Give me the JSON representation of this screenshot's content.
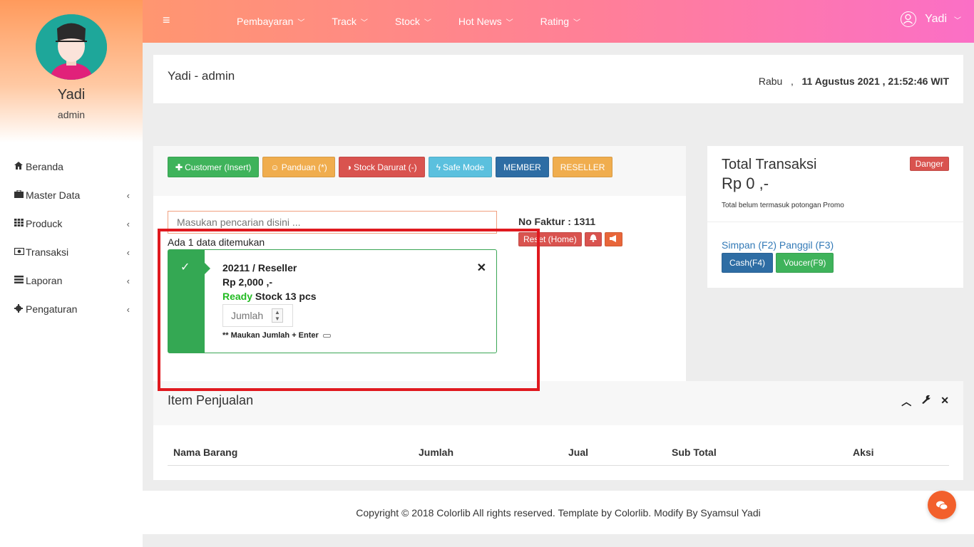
{
  "sidebar": {
    "profile": {
      "name": "Yadi",
      "role": "admin"
    },
    "items": [
      {
        "label": "Beranda",
        "icon": "home-icon",
        "has_arrow": false
      },
      {
        "label": "Master Data",
        "icon": "briefcase-icon",
        "has_arrow": true
      },
      {
        "label": "Produck",
        "icon": "grid-icon",
        "has_arrow": true
      },
      {
        "label": "Transaksi",
        "icon": "money-icon",
        "has_arrow": true
      },
      {
        "label": "Laporan",
        "icon": "list-icon",
        "has_arrow": true
      },
      {
        "label": "Pengaturan",
        "icon": "gear-icon",
        "has_arrow": true
      }
    ],
    "arrow": "‹"
  },
  "topbar": {
    "menu_icon": "≡",
    "nav": [
      "Pembayaran",
      "Track",
      "Stock",
      "Hot News",
      "Rating"
    ],
    "user": "Yadi"
  },
  "header": {
    "title": "Yadi - admin",
    "day": "Rabu",
    "separator": ",",
    "datetime": "11 Agustus 2021 , 21:52:46 WIT"
  },
  "actions": {
    "customer": "Customer (Insert)",
    "panduan": "Panduan (*)",
    "stock_darurat": "Stock Darurat (-)",
    "safe_mode": "Safe Mode",
    "member": "MEMBER",
    "reseller": "RESELLER"
  },
  "search": {
    "placeholder": "Masukan pencarian disini ...",
    "found_text": "Ada 1 data ditemukan"
  },
  "faktur": {
    "label": "No Faktur : 1311",
    "reset": "Reset (Home)"
  },
  "result": {
    "title": "20211 / Reseller",
    "price": "Rp 2,000 ,-",
    "ready": "Ready",
    "stock": "Stock 13 pcs",
    "qty_placeholder": "Jumlah",
    "hint": "** Maukan Jumlah + Enter"
  },
  "summary": {
    "title": "Total Transaksi",
    "amount": "Rp 0 ,-",
    "note": "Total belum termasuk potongan Promo",
    "danger": "Danger",
    "simpan": "Simpan (F2)",
    "panggil": "Panggil (F3)",
    "cash": "Cash(F4)",
    "voucher": "Voucer(F9)"
  },
  "items": {
    "title": "Item Penjualan",
    "columns": [
      "Nama Barang",
      "Jumlah",
      "Jual",
      "Sub Total",
      "Aksi"
    ]
  },
  "footer": {
    "text": "Copyright © 2018 Colorlib All rights reserved. Template by Colorlib. Modify By Syamsul Yadi"
  },
  "colors": {
    "highlight": "#e0191f",
    "success": "#34a853",
    "primary": "#337ab7",
    "danger": "#d9534f"
  }
}
